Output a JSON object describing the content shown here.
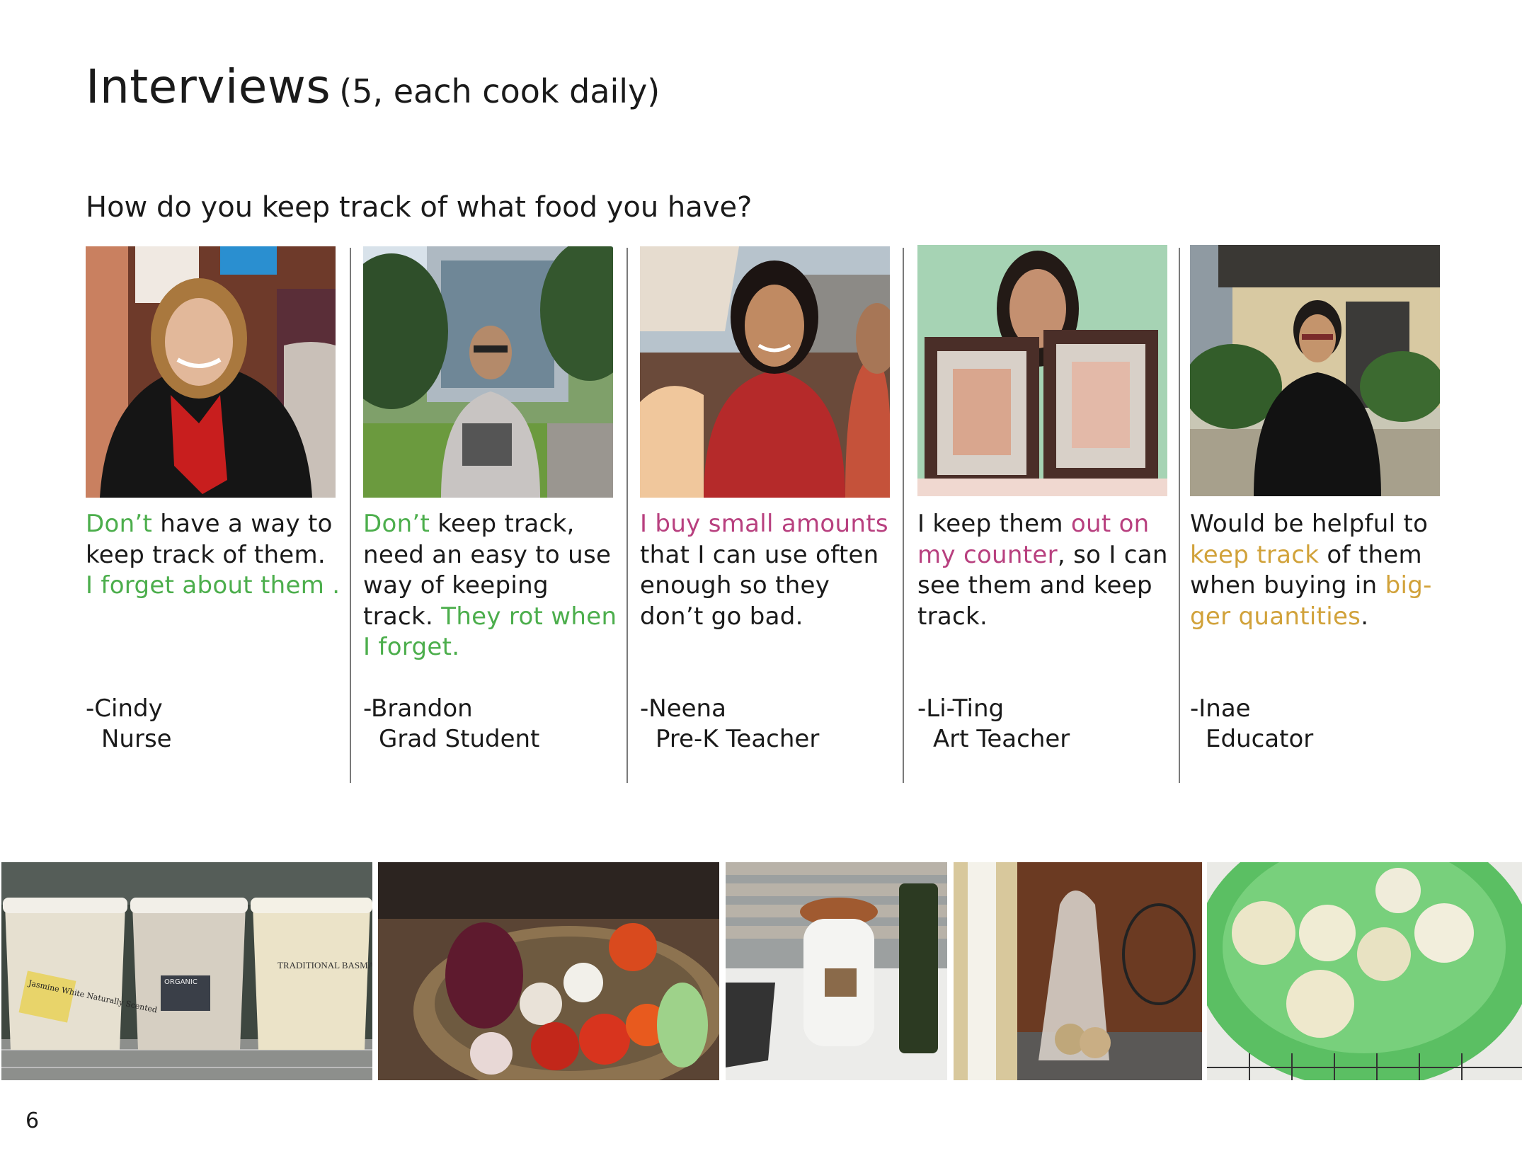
{
  "title": {
    "main": "Interviews",
    "sub": "(5, each cook daily)"
  },
  "question": "How do you keep track of what food you have?",
  "interviews": [
    {
      "photo_label": "Portrait of Cindy",
      "quote": [
        {
          "t": "Don’t",
          "c": "g"
        },
        {
          "t": " have a way to keep track of them. ",
          "c": ""
        },
        {
          "t": "I forget about them .",
          "c": "g"
        }
      ],
      "name": "-Cindy",
      "role": "Nurse"
    },
    {
      "photo_label": "Portrait of Brandon",
      "quote": [
        {
          "t": "Don’t",
          "c": "g"
        },
        {
          "t": " keep track, need an easy to use way of keeping track. ",
          "c": ""
        },
        {
          "t": "They rot when I forget.",
          "c": "g"
        }
      ],
      "name": "-Brandon",
      "role": "Grad Student"
    },
    {
      "photo_label": "Portrait of Neena",
      "quote": [
        {
          "t": "I buy small amounts",
          "c": "p"
        },
        {
          "t": " that I can use often enough so they don’t go bad.",
          "c": ""
        }
      ],
      "name": "-Neena",
      "role": "Pre-K Teacher"
    },
    {
      "photo_label": "Portrait of Li-Ting",
      "quote": [
        {
          "t": "I keep them ",
          "c": ""
        },
        {
          "t": "out on my counter",
          "c": "p"
        },
        {
          "t": ", so I can see them and keep track.",
          "c": ""
        }
      ],
      "name": "-Li-Ting",
      "role": "Art Teacher"
    },
    {
      "photo_label": "Portrait of Inae",
      "quote": [
        {
          "t": "Would be helpful to ",
          "c": ""
        },
        {
          "t": "keep track",
          "c": "y"
        },
        {
          "t": " of them when buying in ",
          "c": ""
        },
        {
          "t": "big-ger quantities",
          "c": "y"
        },
        {
          "t": ".",
          "c": ""
        }
      ],
      "name": "-Inae",
      "role": "Educator"
    }
  ],
  "bottom_photos": {
    "rice": {
      "label1": "Jasmine White Naturally Scented",
      "label2": "ORGANIC",
      "label3": "TRADITIONAL BASMATI RICE"
    },
    "basket": "Basket of onions, tomatoes, garlic",
    "jar": "Ceramic storage jar on counter",
    "bag": "Bag of onions",
    "bowl": "Green bowl of onions"
  },
  "page_number": "6"
}
